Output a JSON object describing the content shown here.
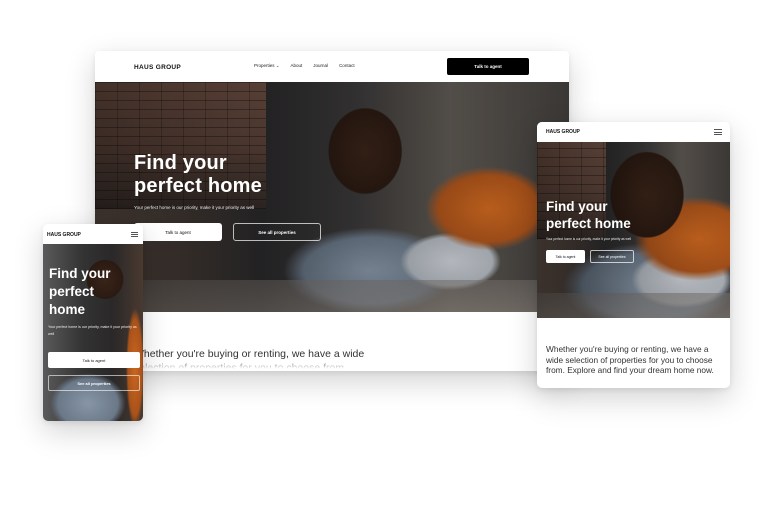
{
  "brand": {
    "logo": "HAUS GROUP"
  },
  "desktop": {
    "nav": {
      "items": [
        "Properties ⌄",
        "About",
        "Journal",
        "Contact"
      ],
      "cta": "Talk to agent"
    },
    "hero": {
      "title_line1": "Find your",
      "title_line2": "perfect home",
      "subtitle": "Your perfect home is our priority, make it your priority as well",
      "primary_button": "Talk to agent",
      "secondary_button": "See all properties"
    },
    "body_text": "Whether you're buying or renting, we have a wide selection of properties for you to choose from."
  },
  "tablet": {
    "hero": {
      "title_line1": "Find your",
      "title_line2": "perfect home",
      "subtitle": "Your perfect home is our priority, make it your priority as well",
      "primary_button": "Talk to agent",
      "secondary_button": "See all properties"
    },
    "body_text": "Whether you're buying or renting, we have a wide selection of properties for you to choose from. Explore and find your dream home now."
  },
  "phone": {
    "hero": {
      "title_line1": "Find your",
      "title_line2": "perfect",
      "title_line3": "home",
      "subtitle": "Your perfect home is our priority, make it your priority as well",
      "primary_button": "Talk to agent",
      "secondary_button": "See all properties"
    }
  },
  "colors": {
    "cta_background": "#000000",
    "accent_orange": "#c9661f",
    "text_dark": "#333333"
  }
}
